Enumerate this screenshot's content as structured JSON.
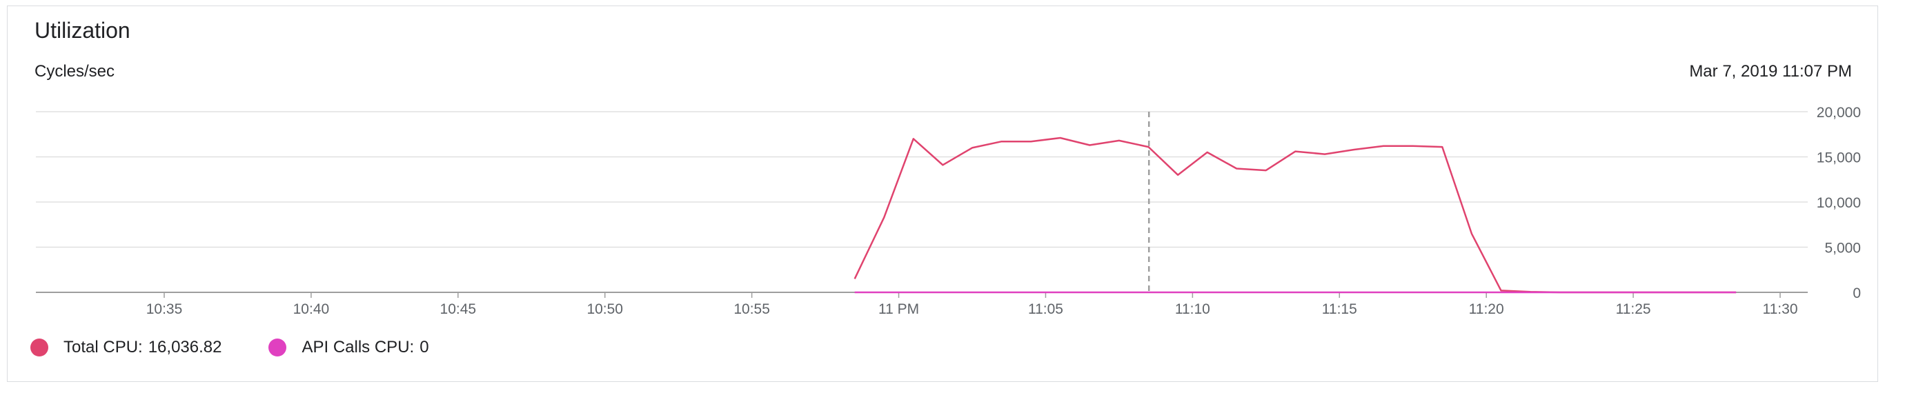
{
  "card": {
    "title": "Utilization",
    "unit_label": "Cycles/sec",
    "hover_timestamp": "Mar 7, 2019 11:07 PM"
  },
  "legend": [
    {
      "label": "Total CPU:",
      "value": "16,036.82",
      "color": "#e0436e",
      "icon": "legend-dot"
    },
    {
      "label": "API Calls CPU:",
      "value": "0",
      "color": "#e040c0",
      "icon": "legend-dot"
    }
  ],
  "chart_data": {
    "type": "line",
    "xlabel": "",
    "ylabel": "Cycles/sec",
    "ylim": [
      0,
      20000
    ],
    "yticks": [
      0,
      5000,
      10000,
      15000,
      20000
    ],
    "ytick_labels": [
      "0",
      "5,000",
      "10,000",
      "15,000",
      "20,000"
    ],
    "xlim": [
      "10:31",
      "11:31"
    ],
    "xticks": [
      "10:35",
      "10:40",
      "10:45",
      "10:50",
      "10:55",
      "11:00",
      "11:05",
      "11:10",
      "11:15",
      "11:20",
      "11:25",
      "11:30"
    ],
    "xtick_labels": [
      "10:35",
      "10:40",
      "10:45",
      "10:50",
      "10:55",
      "11 PM",
      "11:05",
      "11:10",
      "11:15",
      "11:20",
      "11:25",
      "11:30"
    ],
    "grid": true,
    "hover_marker_time": "11:08",
    "series": [
      {
        "name": "Total CPU",
        "color": "#e0436e",
        "x": [
          "10:58.5",
          "10:59.5",
          "11:00.5",
          "11:01.5",
          "11:02.5",
          "11:03.5",
          "11:04.5",
          "11:05.5",
          "11:06.5",
          "11:07.5",
          "11:08.5",
          "11:09.5",
          "11:10.5",
          "11:11.5",
          "11:12.5",
          "11:13.5",
          "11:14.5",
          "11:15.5",
          "11:16.5",
          "11:17.5",
          "11:18.5",
          "11:19.5",
          "11:20.5",
          "11:21.5",
          "11:22.5",
          "11:23.5",
          "11:24.5",
          "11:25.5",
          "11:26.5",
          "11:27.5",
          "11:28.5"
        ],
        "y": [
          1500,
          8300,
          17000,
          14100,
          16000,
          16700,
          16700,
          17100,
          16300,
          16800,
          16100,
          13000,
          15500,
          13700,
          13500,
          15600,
          15300,
          15800,
          16200,
          16200,
          16100,
          6500,
          200,
          50,
          0,
          0,
          0,
          0,
          0,
          0,
          0
        ]
      },
      {
        "name": "API Calls CPU",
        "color": "#e040c0",
        "x": [
          "10:58.5",
          "11:28.5"
        ],
        "y": [
          0,
          0
        ]
      }
    ]
  }
}
